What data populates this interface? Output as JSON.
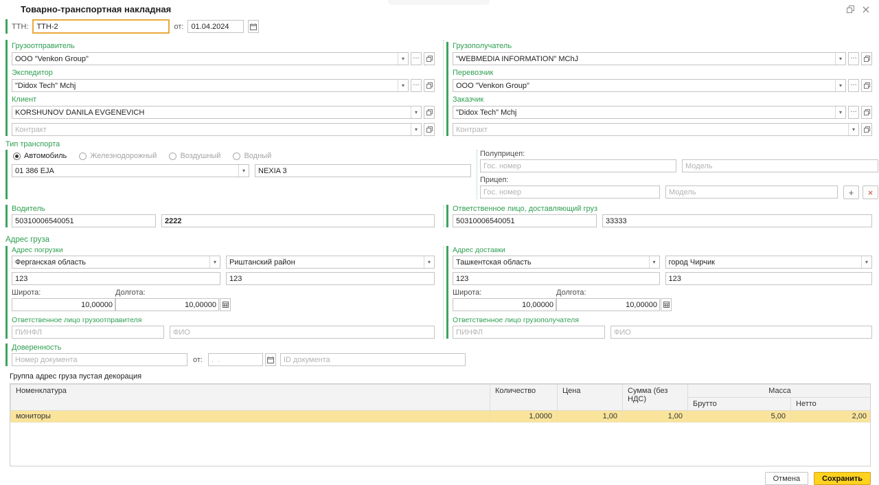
{
  "window": {
    "title": "Товарно-транспортная накладная"
  },
  "icons": {
    "dropdown": "▾",
    "more": "…",
    "add": "+",
    "remove": "×"
  },
  "ttn": {
    "label": "ТТН:",
    "value": "ТТН-2",
    "date_label": "от:",
    "date_value": "01.04.2024"
  },
  "parties": {
    "shipper": {
      "label": "Грузоотправитель",
      "value": "ООО \"Venkon Group\""
    },
    "consignee": {
      "label": "Грузополучатель",
      "value": "\"WEBMEDIA INFORMATION\" MChJ"
    },
    "forwarder": {
      "label": "Экспедитор",
      "value": "\"Didox Tech\" Mchj"
    },
    "carrier": {
      "label": "Перевозчик",
      "value": "ООО \"Venkon Group\""
    },
    "client": {
      "label": "Клиент",
      "value": "KORSHUNOV DANILA EVGENEVICH"
    },
    "customer": {
      "label": "Заказчик",
      "value": "\"Didox Tech\" Mchj"
    },
    "contract_placeholder": "Контракт"
  },
  "transport": {
    "label": "Тип транспорта",
    "radios": [
      "Автомобиль",
      "Железнодорожный",
      "Воздушный",
      "Водный"
    ],
    "vehicle_number": "01 386 EJA",
    "vehicle_model": "NEXIA 3",
    "semitrailer_label": "Полуприцеп:",
    "trailer_label": "Прицеп:",
    "gov_number_placeholder": "Гос. номер",
    "model_placeholder": "Модель"
  },
  "driver": {
    "label": "Водитель",
    "pinfl": "50310006540051",
    "name": "2222"
  },
  "responsible": {
    "label": "Ответственное лицо, доставляющий груз",
    "pinfl": "50310006540051",
    "name": "33333"
  },
  "cargo_address": {
    "label": "Адрес груза",
    "loading": {
      "label": "Адрес погрузки",
      "region": "Ферганская область",
      "district": "Риштанский район",
      "address1": "123",
      "address2": "123",
      "lat_label": "Широта:",
      "lat": "10,00000",
      "lon_label": "Долгота:",
      "lon": "10,00000",
      "responsible_label": "Ответственное лицо грузоотправителя",
      "pinfl_placeholder": "ПИНФЛ",
      "fio_placeholder": "ФИО"
    },
    "delivery": {
      "label": "Адрес доставки",
      "region": "Ташкентская область",
      "district": "город Чирчик",
      "address1": "123",
      "address2": "123",
      "lat_label": "Широта:",
      "lat": "10,00000",
      "lon_label": "Долгота:",
      "lon": "10,00000",
      "responsible_label": "Ответственное лицо грузополучателя",
      "pinfl_placeholder": "ПИНФЛ",
      "fio_placeholder": "ФИО"
    }
  },
  "proxy": {
    "label": "Доверенность",
    "number_placeholder": "Номер документа",
    "date_label": "от:",
    "date_placeholder": ".  .",
    "id_placeholder": "ID документа"
  },
  "decoration_note": "Группа адрес груза пустая декорация",
  "table": {
    "headers": {
      "nomenclature": "Номенклатура",
      "quantity": "Количество",
      "price": "Цена",
      "sum": "Сумма (без НДС)",
      "mass": "Масса",
      "gross": "Брутто",
      "net": "Нетто"
    },
    "rows": [
      {
        "nomenclature": "мониторы",
        "quantity": "1,0000",
        "price": "1,00",
        "sum": "1,00",
        "gross": "5,00",
        "net": "2,00"
      }
    ]
  },
  "footer": {
    "cancel": "Отмена",
    "save": "Сохранить"
  },
  "colors": {
    "accent_green": "#2e9e50",
    "focus_orange": "#e9a93d",
    "selected_row": "#fae49b",
    "save_yellow": "#ffd21f"
  }
}
